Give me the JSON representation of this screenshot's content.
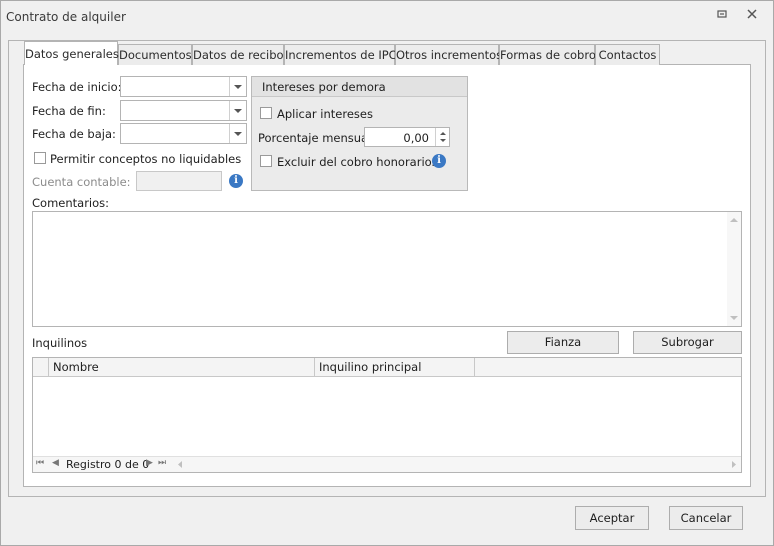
{
  "window": {
    "title": "Contrato de alquiler"
  },
  "tabs": [
    {
      "label": "Datos generales"
    },
    {
      "label": "Documentos"
    },
    {
      "label": "Datos de recibo"
    },
    {
      "label": "Incrementos de IPC"
    },
    {
      "label": "Otros incrementos"
    },
    {
      "label": "Formas de cobro"
    },
    {
      "label": "Contactos"
    }
  ],
  "form": {
    "fecha_inicio": {
      "label": "Fecha de inicio:",
      "value": ""
    },
    "fecha_fin": {
      "label": "Fecha de fin:",
      "value": ""
    },
    "fecha_baja": {
      "label": "Fecha de baja:",
      "value": ""
    },
    "permitir": {
      "label": "Permitir conceptos no liquidables",
      "checked": false
    },
    "cuenta": {
      "label": "Cuenta contable:",
      "value": ""
    }
  },
  "intereses": {
    "header": "Intereses por demora",
    "aplicar": {
      "label": "Aplicar intereses",
      "checked": false
    },
    "porcentaje": {
      "label": "Porcentaje mensual:",
      "value": "0,00"
    },
    "excluir": {
      "label": "Excluir del cobro honorarios",
      "checked": false
    }
  },
  "comentarios": {
    "label": "Comentarios:",
    "value": ""
  },
  "inquilinos": {
    "label": "Inquilinos",
    "fianza_button": "Fianza",
    "subrogar_button": "Subrogar",
    "columns": [
      "Nombre",
      "Inquilino principal"
    ],
    "rows": [],
    "record_text": "Registro 0 de 0"
  },
  "footer": {
    "accept": "Aceptar",
    "cancel": "Cancelar"
  },
  "colors": {
    "info_icon": "#3a78c4",
    "background": "#f0f0f0",
    "border": "#b4b4b4"
  }
}
